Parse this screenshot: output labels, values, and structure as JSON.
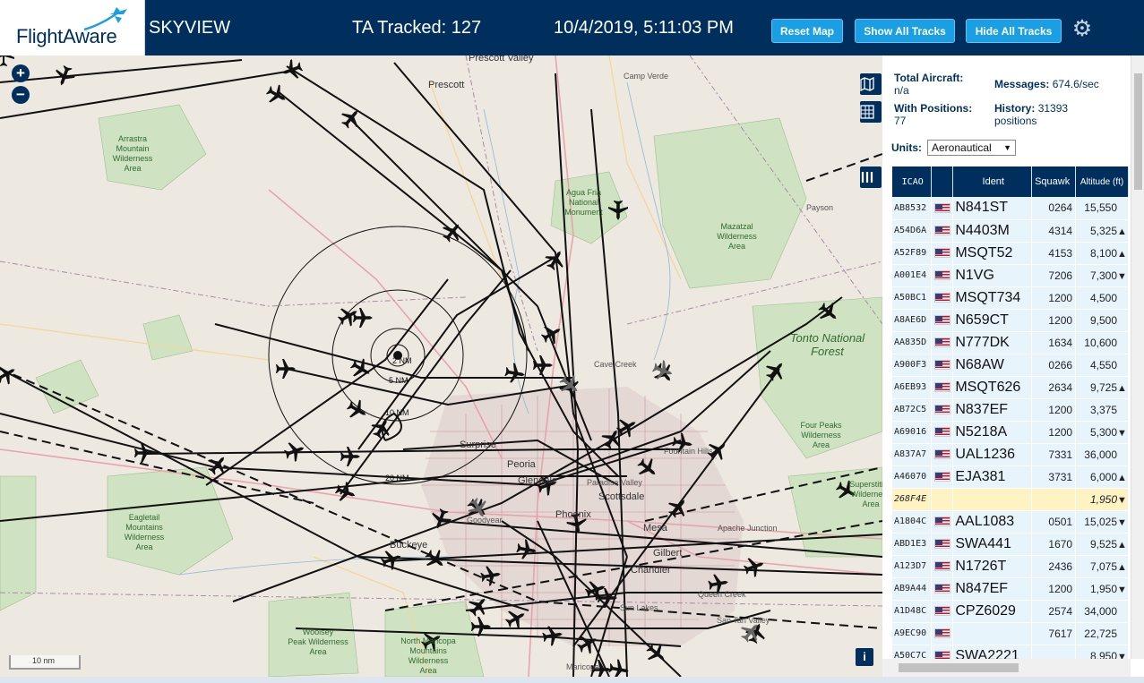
{
  "header": {
    "logo_text": "FlightAware",
    "app_title": "SKYVIEW",
    "ta_tracked_label": "TA Tracked: 127",
    "clock": "10/4/2019, 5:11:03 PM",
    "buttons": {
      "reset_map": "Reset Map",
      "show_all_tracks": "Show All Tracks",
      "hide_all_tracks": "Hide All Tracks"
    },
    "gear_icon": "gear-icon"
  },
  "map": {
    "zoom_in": "+",
    "zoom_out": "−",
    "scale_label": "10 nm",
    "info_label": "i",
    "range_rings": [
      "2 NM",
      "5 NM",
      "10 NM",
      "20 NM"
    ],
    "labels": {
      "prescott_valley": "Prescott Valley",
      "prescott": "Prescott",
      "camp_verde": "Camp Verde",
      "arrastra": "Arrastra\nMountain\nWilderness\nArea",
      "agua_fria": "Agua Fria\nNational\nMonument",
      "mazatzal": "Mazatzal\nWilderness\nArea",
      "payson": "Payson",
      "tonto": "Tonto National\nForest",
      "cave_creek": "Cave Creek",
      "four_peaks": "Four Peaks\nWilderness\nArea",
      "fountain_hills": "Fountain Hills",
      "surprise": "Surprise",
      "peoria": "Peoria",
      "glendale": "Glendale",
      "paradise_valley": "Paradise Valley",
      "scottsdale": "Scottsdale",
      "phoenix": "Phoenix",
      "goodyear": "Goodyear",
      "eagletail": "Eagletail\nMountains\nWilderness\nArea",
      "buckeye": "Buckeye",
      "mesa": "Mesa",
      "apache_junction": "Apache Junction",
      "gilbert": "Gilbert",
      "chandler": "Chandler",
      "queen_creek": "Queen Creek",
      "sun_lakes": "Sun Lakes",
      "san_tan_valley": "San Tan Valley",
      "superstition": "Superstition\nWilderness\nArea",
      "woolsey": "Woolsey\nPeak Wilderness\nArea",
      "north_maricopa": "North Maricopa\nMountains\nWilderness\nArea",
      "maricopa": "Maricopa"
    },
    "controls": {
      "map_layers_icon": "map-icon",
      "grid_icon": "grid-icon",
      "columns_icon": "columns-icon"
    }
  },
  "panel": {
    "stats": {
      "total_aircraft_label": "Total Aircraft:",
      "total_aircraft_value": "n/a",
      "messages_label": "Messages:",
      "messages_value": "674.6/sec",
      "with_positions_label": "With Positions:",
      "with_positions_value": "77",
      "history_label": "History:",
      "history_value": "31393",
      "history_unit": "positions"
    },
    "units_label": "Units:",
    "units_value": "Aeronautical",
    "columns": [
      "ICAO",
      "",
      "Ident",
      "Squawk",
      "Altitude (ft)"
    ],
    "rows": [
      {
        "icao": "AB8532",
        "ident": "N841ST",
        "squawk": "0264",
        "alt": "15,550",
        "arrow": ""
      },
      {
        "icao": "A54D6A",
        "ident": "N4403M",
        "squawk": "4314",
        "alt": "5,325",
        "arrow": "▲"
      },
      {
        "icao": "A52F89",
        "ident": "MSQT52",
        "squawk": "4153",
        "alt": "8,100",
        "arrow": "▲"
      },
      {
        "icao": "A001E4",
        "ident": "N1VG",
        "squawk": "7206",
        "alt": "7,300",
        "arrow": "▼"
      },
      {
        "icao": "A50BC1",
        "ident": "MSQT734",
        "squawk": "1200",
        "alt": "4,500",
        "arrow": ""
      },
      {
        "icao": "A8AE6D",
        "ident": "N659CT",
        "squawk": "1200",
        "alt": "9,500",
        "arrow": ""
      },
      {
        "icao": "AA835D",
        "ident": "N777DK",
        "squawk": "1634",
        "alt": "10,600",
        "arrow": ""
      },
      {
        "icao": "A900F3",
        "ident": "N68AW",
        "squawk": "0266",
        "alt": "4,550",
        "arrow": ""
      },
      {
        "icao": "A6EB93",
        "ident": "MSQT626",
        "squawk": "2634",
        "alt": "9,725",
        "arrow": "▲"
      },
      {
        "icao": "AB72C5",
        "ident": "N837EF",
        "squawk": "1200",
        "alt": "3,375",
        "arrow": ""
      },
      {
        "icao": "A69016",
        "ident": "N5218A",
        "squawk": "1200",
        "alt": "5,300",
        "arrow": "▼"
      },
      {
        "icao": "A837A7",
        "ident": "UAL1236",
        "squawk": "7331",
        "alt": "36,000",
        "arrow": ""
      },
      {
        "icao": "A46070",
        "ident": "EJA381",
        "squawk": "3731",
        "alt": "6,000",
        "arrow": "▲"
      },
      {
        "icao": "268F4E",
        "ident": "",
        "squawk": "",
        "alt": "1,950",
        "arrow": "▼",
        "selected": true,
        "noflag": true
      },
      {
        "icao": "A1804C",
        "ident": "AAL1083",
        "squawk": "0501",
        "alt": "15,025",
        "arrow": "▼"
      },
      {
        "icao": "ABD1E3",
        "ident": "SWA441",
        "squawk": "1670",
        "alt": "9,525",
        "arrow": "▲"
      },
      {
        "icao": "A123D7",
        "ident": "N1726T",
        "squawk": "2436",
        "alt": "7,075",
        "arrow": "▲"
      },
      {
        "icao": "AB9A44",
        "ident": "N847EF",
        "squawk": "1200",
        "alt": "1,950",
        "arrow": "▼"
      },
      {
        "icao": "A1D48C",
        "ident": "CPZ6029",
        "squawk": "2574",
        "alt": "34,000",
        "arrow": ""
      },
      {
        "icao": "A9EC90",
        "ident": "",
        "squawk": "7617",
        "alt": "22,725",
        "arrow": ""
      },
      {
        "icao": "A50C7C",
        "ident": "SWA2221",
        "squawk": "",
        "alt": "8,950",
        "arrow": "▼"
      }
    ]
  }
}
